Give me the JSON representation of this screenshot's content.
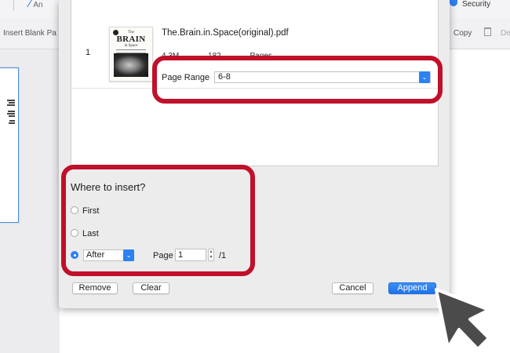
{
  "background": {
    "toolbar_partial_left": "An",
    "security_label": "Security",
    "insert_blank_label": "Insert Blank Pa",
    "copy_label": "Copy",
    "delete_partial": "De"
  },
  "dialog": {
    "file": {
      "index": "1",
      "name": "The.Brain.in.Space(original).pdf",
      "size": "4.3M",
      "pages": "182 Pages",
      "thumbnail": {
        "line1": "The",
        "line2": "BRAIN",
        "line3": "in Space"
      }
    },
    "page_range": {
      "label": "Page Range",
      "value": "6-8"
    },
    "where": {
      "title": "Where to insert?",
      "options": [
        {
          "label": "First",
          "selected": false
        },
        {
          "label": "Last",
          "selected": false
        },
        {
          "label": "After",
          "selected": true
        }
      ],
      "after_value": "After",
      "page_label": "Page",
      "page_value": "1",
      "page_total": "/1"
    },
    "buttons": {
      "remove": "Remove",
      "clear": "Clear",
      "cancel": "Cancel",
      "append": "Append"
    }
  },
  "colors": {
    "accent": "#2d82f0",
    "highlight": "#c0102a"
  },
  "icons": [
    "pen-icon",
    "shield-icon",
    "trash-icon",
    "chevron-down-icon",
    "stepper-icon",
    "mouse-cursor-icon"
  ]
}
